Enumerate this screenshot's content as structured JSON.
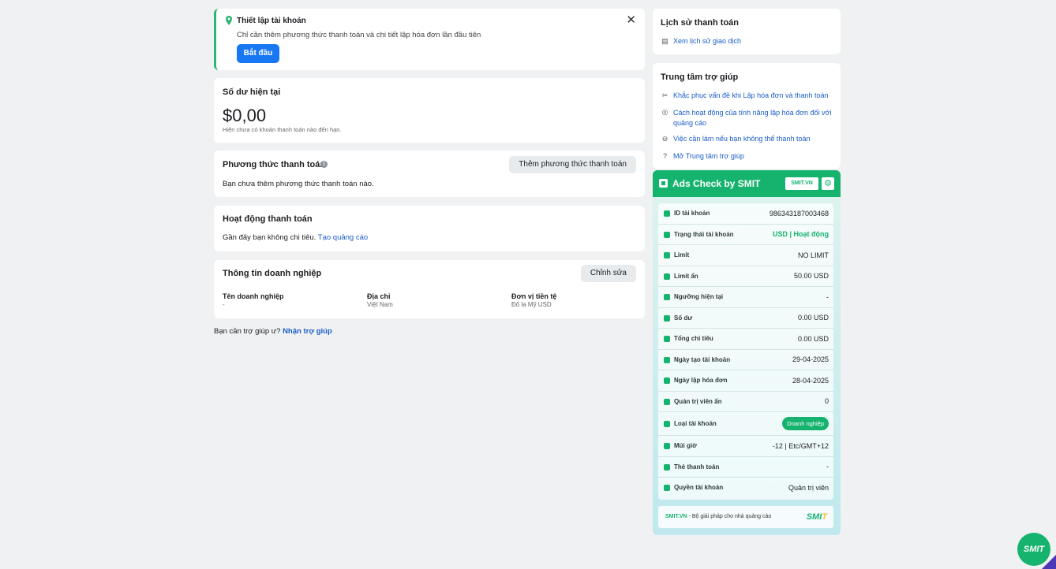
{
  "setup": {
    "title": "Thiết lập tài khoản",
    "description": "Chỉ cần thêm phương thức thanh toán và chi tiết lập hóa đơn lần đầu tiên",
    "start_label": "Bắt đầu",
    "close": "✕"
  },
  "balance": {
    "title": "Số dư hiện tại",
    "amount": "$0,00",
    "note": "Hiện chưa có khoản thanh toán nào đến hạn."
  },
  "payment_method": {
    "title": "Phương thức thanh toán",
    "info": "i",
    "add_label": "Thêm phương thức thanh toán",
    "empty": "Bạn chưa thêm phương thức thanh toán nào."
  },
  "activity": {
    "title": "Hoạt động thanh toán",
    "desc": "Gần đây bạn không chi tiêu.",
    "link": "Tạo quảng cáo"
  },
  "business": {
    "title": "Thông tin doanh nghiệp",
    "edit_label": "Chỉnh sửa",
    "columns": [
      {
        "label": "Tên doanh nghiệp",
        "value": "-"
      },
      {
        "label": "Địa chỉ",
        "value": "Việt Nam"
      },
      {
        "label": "Đơn vị tiền tệ",
        "value": "Đô la Mỹ USD"
      }
    ]
  },
  "help_line": {
    "text": "Bạn cần trợ giúp ư?",
    "link": "Nhận trợ giúp"
  },
  "history": {
    "title": "Lịch sử thanh toán",
    "link": "Xem lịch sử giao dịch"
  },
  "help_center": {
    "title": "Trung tâm trợ giúp",
    "links": [
      "Khắc phục vấn đề khi Lập hóa đơn và thanh toán",
      "Cách hoạt động của tính năng lập hóa đơn đối với quảng cáo",
      "Việc cần làm nếu bạn không thể thanh toán",
      "Mở Trung tâm trợ giúp"
    ]
  },
  "ads_check": {
    "title": "Ads Check by SMIT",
    "site": "SMIT.VN",
    "gear": "⚙",
    "rows": [
      {
        "label": "ID tài khoản",
        "value": "986343187003468"
      },
      {
        "label": "Trạng thái tài khoản",
        "value": "USD | Hoạt động"
      },
      {
        "label": "Limit",
        "value": "NO LIMIT"
      },
      {
        "label": "Limit ẩn",
        "value": "50.00 USD"
      },
      {
        "label": "Ngưỡng hiện tại",
        "value": "-"
      },
      {
        "label": "Số dư",
        "value": "0.00 USD"
      },
      {
        "label": "Tổng chi tiêu",
        "value": "0.00 USD"
      },
      {
        "label": "Ngày tạo tài khoản",
        "value": "29-04-2025"
      },
      {
        "label": "Ngày lập hóa đơn",
        "value": "28-04-2025"
      },
      {
        "label": "Quản trị viên ẩn",
        "value": "0"
      },
      {
        "label": "Loại tài khoản",
        "value": "Doanh nghiệp"
      },
      {
        "label": "Múi giờ",
        "value": "-12 | Etc/GMT+12"
      },
      {
        "label": "Thẻ thanh toán",
        "value": "-"
      },
      {
        "label": "Quyền tài khoản",
        "value": "Quản trị viên"
      }
    ],
    "footer_site": "SMIT.VN",
    "footer_text": "- Bộ giải pháp cho nhà quảng cáo",
    "brand": "SMI",
    "brand_tail": "T"
  },
  "float_button": "SMIT",
  "colors": {
    "accent_green": "#16b36e",
    "link_blue": "#1a5dc8",
    "primary_blue": "#1877f2"
  }
}
